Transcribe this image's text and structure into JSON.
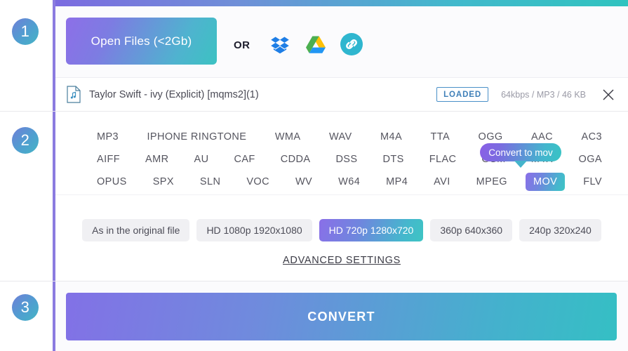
{
  "steps": {
    "one": "1",
    "two": "2",
    "three": "3"
  },
  "step1": {
    "open_files_label": "Open Files (<2Gb)",
    "or_label": "OR",
    "cloud_sources": [
      "dropbox-icon",
      "google-drive-icon",
      "url-link-icon"
    ]
  },
  "file": {
    "name": "Taylor Swift - ivy (Explicit) [mqms2](1)",
    "status": "LOADED",
    "meta": "64kbps / MP3 / 46 KB",
    "remove_label": "close-icon"
  },
  "formats": {
    "row1": [
      "MP3",
      "IPHONE RINGTONE",
      "WMA",
      "WAV",
      "M4A",
      "TTA",
      "OGG",
      "AAC",
      "AC3"
    ],
    "row2": [
      "AIFF",
      "AMR",
      "AU",
      "CAF",
      "CDDA",
      "DSS",
      "DTS",
      "FLAC",
      "GSM",
      "M4R",
      "OGA"
    ],
    "row3": [
      "OPUS",
      "SPX",
      "SLN",
      "VOC",
      "WV",
      "W64",
      "MP4",
      "AVI",
      "MPEG",
      "MOV",
      "FLV"
    ],
    "selected": "MOV"
  },
  "tooltip": {
    "text": "Convert to mov"
  },
  "quality": {
    "options": [
      "As in the original file",
      "HD 1080p 1920x1080",
      "HD 720p 1280x720",
      "360p 640x360",
      "240p 320x240"
    ],
    "selected": "HD 720p 1280x720"
  },
  "advanced_settings_label": "ADVANCED SETTINGS",
  "step3": {
    "convert_label": "CONVERT"
  },
  "colors": {
    "gradient_start": "#8a6fe8",
    "gradient_end": "#3ec5c3",
    "rail": "#8b7be0",
    "badge_border": "#4a90c8",
    "quality_bg": "#f0f0f3"
  }
}
